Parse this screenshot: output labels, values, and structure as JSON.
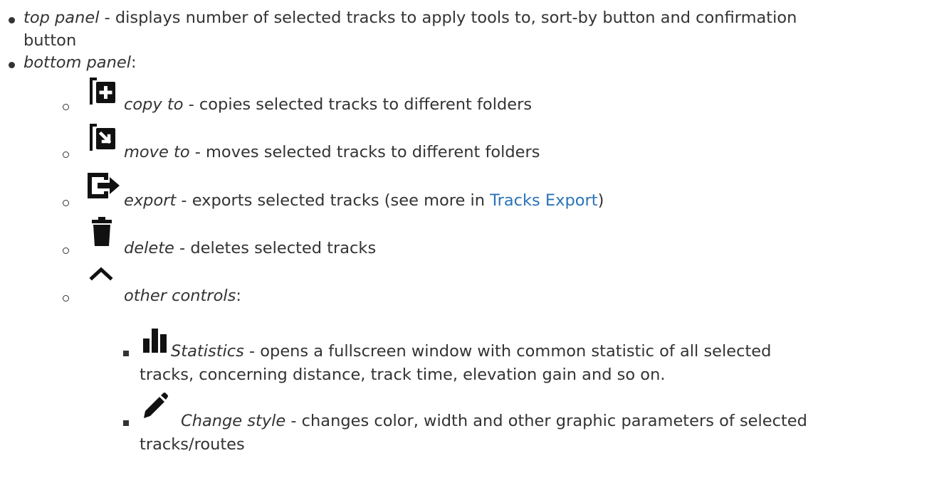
{
  "items": {
    "top_panel": {
      "term": "top panel",
      "desc_line1": " - displays number of selected tracks to apply tools to, sort-by button and confirmation",
      "desc_line2": "button"
    },
    "bottom_panel": {
      "term": "bottom panel",
      "suffix": ":"
    },
    "copy_to": {
      "icon": "copy-plus-icon",
      "term": "copy to",
      "desc": " - copies selected tracks to different folders"
    },
    "move_to": {
      "icon": "move-to-icon",
      "term": "move to",
      "desc": " - moves selected tracks to different folders"
    },
    "export": {
      "icon": "export-icon",
      "term": "export",
      "desc_before": " - exports selected tracks (see more in ",
      "link": "Tracks Export",
      "desc_after": ")"
    },
    "delete": {
      "icon": "trash-icon",
      "term": "delete",
      "desc": " - deletes selected tracks"
    },
    "other_controls": {
      "icon": "chevron-up-icon",
      "term": "other controls",
      "suffix": ":"
    },
    "statistics": {
      "icon": "bar-chart-icon",
      "term": "Statistics",
      "desc_line1": " - opens a fullscreen window with common statistic of all selected",
      "desc_line2": "tracks, concerning distance, track time, elevation gain and so on."
    },
    "change_style": {
      "icon": "pencil-icon",
      "term": "Change style",
      "desc_line1": " - changes color, width and other graphic parameters of selected",
      "desc_line2": "tracks/routes"
    }
  },
  "colors": {
    "text": "#333333",
    "link": "#2b73b7",
    "icon": "#111111"
  }
}
